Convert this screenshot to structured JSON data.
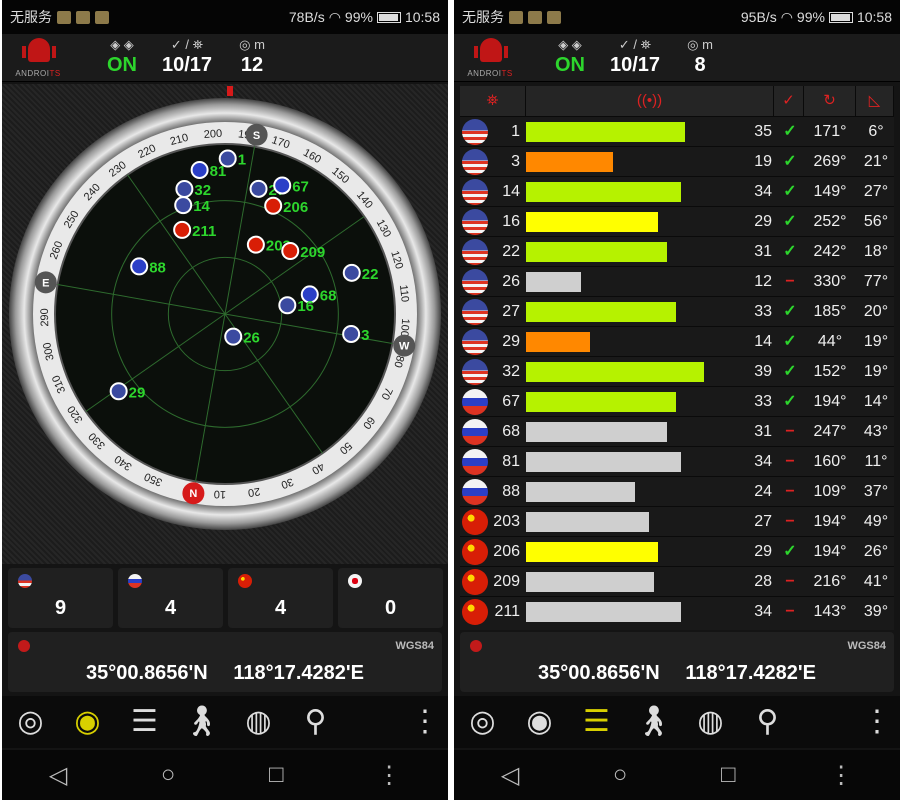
{
  "status": {
    "left": {
      "carrier": "无服务",
      "rate": "78B/s",
      "battery": "99%",
      "time": "10:58"
    },
    "right": {
      "carrier": "无服务",
      "rate": "95B/s",
      "battery": "99%",
      "time": "10:58"
    }
  },
  "header": {
    "left": {
      "fix_state": "ON",
      "sats": "10/17",
      "accuracy": "12",
      "acc_unit": "m"
    },
    "right": {
      "fix_state": "ON",
      "sats": "10/17",
      "accuracy": "8",
      "acc_unit": "m"
    },
    "logo_a": "ANDROI",
    "logo_b": "TS"
  },
  "colors": {
    "green": "#b6f200",
    "orange": "#ff8800",
    "yellow": "#ffff00",
    "gray": "#cfcfcf",
    "accent_red": "#dd2222",
    "fix_green": "#2dd62d"
  },
  "compass": {
    "labels": [
      "S",
      "W",
      "N",
      "E"
    ],
    "degrees": [
      "170",
      "160",
      "150",
      "140",
      "130",
      "120",
      "110",
      "100",
      "80",
      "70",
      "60",
      "50",
      "40",
      "30",
      "20",
      "10",
      "0",
      "350",
      "340",
      "330",
      "320",
      "310",
      "300",
      "290",
      "280",
      "260",
      "250",
      "240",
      "230",
      "220",
      "210",
      "200",
      "190"
    ]
  },
  "radar_sats": [
    {
      "flag": "us",
      "label": "1"
    },
    {
      "flag": "ru",
      "label": "81"
    },
    {
      "flag": "us",
      "label": "32"
    },
    {
      "flag": "us",
      "label": "14"
    },
    {
      "flag": "us",
      "label": "27"
    },
    {
      "flag": "ru",
      "label": "67"
    },
    {
      "flag": "cn",
      "label": "206"
    },
    {
      "flag": "cn",
      "label": "211"
    },
    {
      "flag": "cn",
      "label": "203"
    },
    {
      "flag": "cn",
      "label": "209"
    },
    {
      "flag": "ru",
      "label": "88"
    },
    {
      "flag": "us",
      "label": "22"
    },
    {
      "flag": "ru",
      "label": "68"
    },
    {
      "flag": "us",
      "label": "16"
    },
    {
      "flag": "us",
      "label": "3"
    },
    {
      "flag": "us",
      "label": "26"
    },
    {
      "flag": "us",
      "label": "29"
    }
  ],
  "counts": [
    {
      "flag": "us",
      "value": "9"
    },
    {
      "flag": "ru",
      "value": "4"
    },
    {
      "flag": "cn",
      "value": "4"
    },
    {
      "flag": "jp",
      "value": "0"
    }
  ],
  "coords": {
    "datum": "WGS84",
    "lat": "35°00.8656'N",
    "lon": "118°17.4282'E"
  },
  "table_header": {
    "sat": "⛯",
    "snr": "((•))",
    "used": "✓",
    "azimuth": "↻",
    "elevation": "◺"
  },
  "sat_table": [
    {
      "flag": "us",
      "prn": "1",
      "snr": "35",
      "used": true,
      "az": "171°",
      "el": "6°",
      "color": "#b6f200"
    },
    {
      "flag": "us",
      "prn": "3",
      "snr": "19",
      "used": true,
      "az": "269°",
      "el": "21°",
      "color": "#ff8800"
    },
    {
      "flag": "us",
      "prn": "14",
      "snr": "34",
      "used": true,
      "az": "149°",
      "el": "27°",
      "color": "#b6f200"
    },
    {
      "flag": "us",
      "prn": "16",
      "snr": "29",
      "used": true,
      "az": "252°",
      "el": "56°",
      "color": "#ffff00"
    },
    {
      "flag": "us",
      "prn": "22",
      "snr": "31",
      "used": true,
      "az": "242°",
      "el": "18°",
      "color": "#b6f200"
    },
    {
      "flag": "us",
      "prn": "26",
      "snr": "12",
      "used": false,
      "az": "330°",
      "el": "77°",
      "color": "#cfcfcf"
    },
    {
      "flag": "us",
      "prn": "27",
      "snr": "33",
      "used": true,
      "az": "185°",
      "el": "20°",
      "color": "#b6f200"
    },
    {
      "flag": "us",
      "prn": "29",
      "snr": "14",
      "used": true,
      "az": "44°",
      "el": "19°",
      "color": "#ff8800"
    },
    {
      "flag": "us",
      "prn": "32",
      "snr": "39",
      "used": true,
      "az": "152°",
      "el": "19°",
      "color": "#b6f200"
    },
    {
      "flag": "ru",
      "prn": "67",
      "snr": "33",
      "used": true,
      "az": "194°",
      "el": "14°",
      "color": "#b6f200"
    },
    {
      "flag": "ru",
      "prn": "68",
      "snr": "31",
      "used": false,
      "az": "247°",
      "el": "43°",
      "color": "#cfcfcf"
    },
    {
      "flag": "ru",
      "prn": "81",
      "snr": "34",
      "used": false,
      "az": "160°",
      "el": "11°",
      "color": "#cfcfcf"
    },
    {
      "flag": "ru",
      "prn": "88",
      "snr": "24",
      "used": false,
      "az": "109°",
      "el": "37°",
      "color": "#cfcfcf"
    },
    {
      "flag": "cn",
      "prn": "203",
      "snr": "27",
      "used": false,
      "az": "194°",
      "el": "49°",
      "color": "#cfcfcf"
    },
    {
      "flag": "cn",
      "prn": "206",
      "snr": "29",
      "used": true,
      "az": "194°",
      "el": "26°",
      "color": "#ffff00"
    },
    {
      "flag": "cn",
      "prn": "209",
      "snr": "28",
      "used": false,
      "az": "216°",
      "el": "41°",
      "color": "#cfcfcf"
    },
    {
      "flag": "cn",
      "prn": "211",
      "snr": "34",
      "used": false,
      "az": "143°",
      "el": "39°",
      "color": "#cfcfcf"
    }
  ],
  "toolbar": {
    "icons": [
      "compass-icon",
      "radar-icon",
      "table-icon",
      "walker-icon",
      "globe-icon",
      "pin-icon",
      "menu-icon"
    ]
  },
  "nav": {
    "back": "◁",
    "home": "○",
    "recents": "□",
    "menu": "⋮"
  }
}
